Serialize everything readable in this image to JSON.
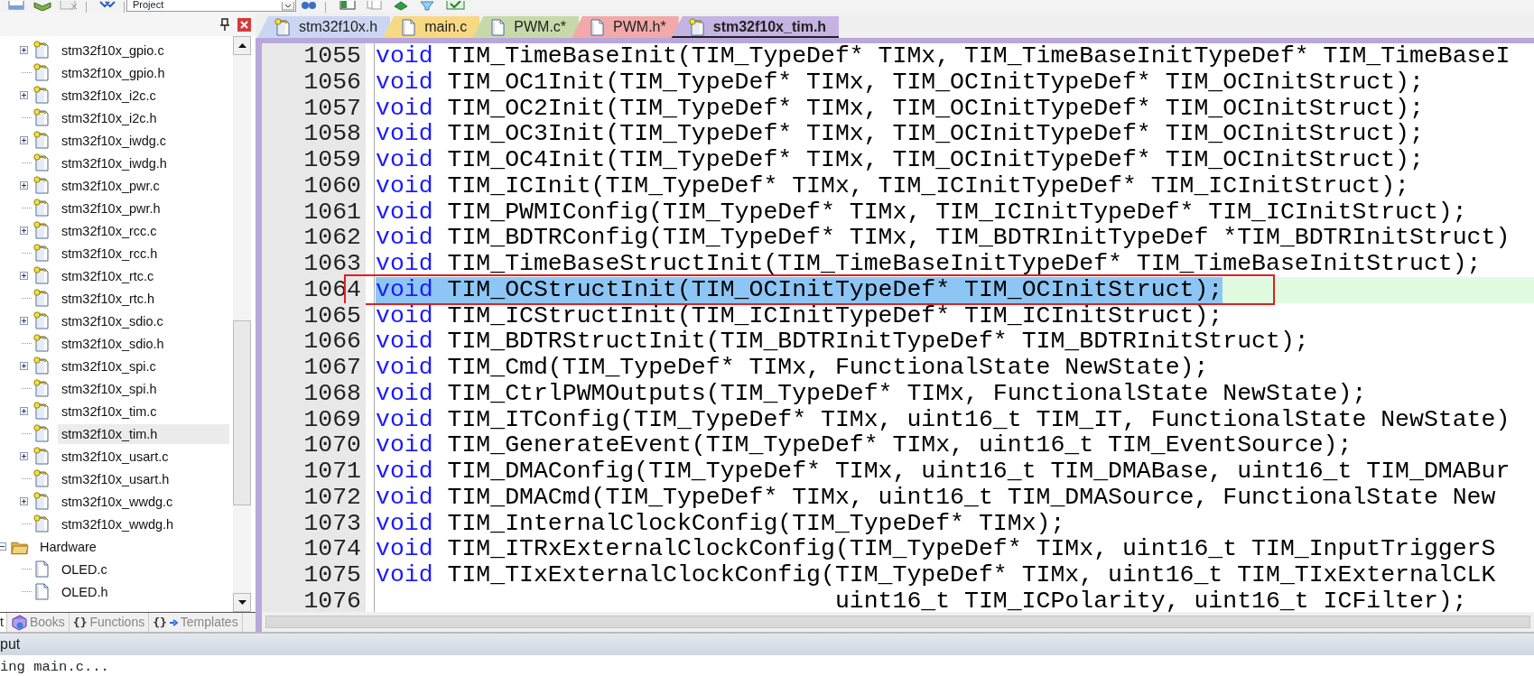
{
  "toolbar": {
    "project_select": "Project"
  },
  "tree": [
    {
      "kind": "group-tail",
      "children": [
        {
          "label": "stm32f10x_gpio.c",
          "kind": "key-file",
          "expandable": true,
          "expanded": false,
          "selected": false
        },
        {
          "label": "stm32f10x_gpio.h",
          "kind": "key-file",
          "expandable": false,
          "expanded": false,
          "selected": false
        },
        {
          "label": "stm32f10x_i2c.c",
          "kind": "key-file",
          "expandable": true,
          "expanded": false,
          "selected": false
        },
        {
          "label": "stm32f10x_i2c.h",
          "kind": "key-file",
          "expandable": false,
          "expanded": false,
          "selected": false
        },
        {
          "label": "stm32f10x_iwdg.c",
          "kind": "key-file",
          "expandable": true,
          "expanded": false,
          "selected": false
        },
        {
          "label": "stm32f10x_iwdg.h",
          "kind": "key-file",
          "expandable": false,
          "expanded": false,
          "selected": false
        },
        {
          "label": "stm32f10x_pwr.c",
          "kind": "key-file",
          "expandable": true,
          "expanded": false,
          "selected": false
        },
        {
          "label": "stm32f10x_pwr.h",
          "kind": "key-file",
          "expandable": false,
          "expanded": false,
          "selected": false
        },
        {
          "label": "stm32f10x_rcc.c",
          "kind": "key-file",
          "expandable": true,
          "expanded": false,
          "selected": false
        },
        {
          "label": "stm32f10x_rcc.h",
          "kind": "key-file",
          "expandable": false,
          "expanded": false,
          "selected": false
        },
        {
          "label": "stm32f10x_rtc.c",
          "kind": "key-file",
          "expandable": true,
          "expanded": false,
          "selected": false
        },
        {
          "label": "stm32f10x_rtc.h",
          "kind": "key-file",
          "expandable": false,
          "expanded": false,
          "selected": false
        },
        {
          "label": "stm32f10x_sdio.c",
          "kind": "key-file",
          "expandable": true,
          "expanded": false,
          "selected": false
        },
        {
          "label": "stm32f10x_sdio.h",
          "kind": "key-file",
          "expandable": false,
          "expanded": false,
          "selected": false
        },
        {
          "label": "stm32f10x_spi.c",
          "kind": "key-file",
          "expandable": true,
          "expanded": false,
          "selected": false
        },
        {
          "label": "stm32f10x_spi.h",
          "kind": "key-file",
          "expandable": false,
          "expanded": false,
          "selected": false
        },
        {
          "label": "stm32f10x_tim.c",
          "kind": "key-file",
          "expandable": true,
          "expanded": false,
          "selected": false
        },
        {
          "label": "stm32f10x_tim.h",
          "kind": "key-file",
          "expandable": false,
          "expanded": false,
          "selected": true
        },
        {
          "label": "stm32f10x_usart.c",
          "kind": "key-file",
          "expandable": true,
          "expanded": false,
          "selected": false
        },
        {
          "label": "stm32f10x_usart.h",
          "kind": "key-file",
          "expandable": false,
          "expanded": false,
          "selected": false
        },
        {
          "label": "stm32f10x_wwdg.c",
          "kind": "key-file",
          "expandable": true,
          "expanded": false,
          "selected": false
        },
        {
          "label": "stm32f10x_wwdg.h",
          "kind": "key-file",
          "expandable": false,
          "expanded": false,
          "selected": false
        }
      ]
    },
    {
      "label": "Hardware",
      "kind": "folder",
      "expandable": true,
      "expanded": true,
      "selected": false,
      "children": [
        {
          "label": "OLED.c",
          "kind": "file",
          "expandable": false,
          "expanded": false,
          "selected": false
        },
        {
          "label": "OLED.h",
          "kind": "file",
          "expandable": false,
          "expanded": false,
          "selected": false
        }
      ]
    }
  ],
  "panel_tabs": [
    {
      "label": "t",
      "kind": "project",
      "selected": true
    },
    {
      "label": "Books",
      "kind": "books",
      "selected": false
    },
    {
      "label": "Functions",
      "kind": "functions",
      "icon_text": "{}",
      "selected": false
    },
    {
      "label": "Templates",
      "kind": "templates",
      "icon_text": "{}",
      "selected": false
    }
  ],
  "editor_tabs": [
    {
      "label": "stm32f10x.h",
      "kind": "key-file",
      "color": "#cbd7f2",
      "selected": false
    },
    {
      "label": "main.c",
      "kind": "file",
      "color": "#f8d983",
      "selected": false
    },
    {
      "label": "PWM.c*",
      "kind": "file",
      "color": "#c8d9a9",
      "selected": false
    },
    {
      "label": "PWM.h*",
      "kind": "file",
      "color": "#f2a9a9",
      "selected": false
    },
    {
      "label": "stm32f10x_tim.h",
      "kind": "key-file",
      "color": "#c5b3e3",
      "selected": true
    }
  ],
  "code_lines": [
    {
      "number": "1055",
      "tokens": [
        {
          "kind": "keyword",
          "text": "void"
        },
        {
          "kind": "plain",
          "text": " TIM_TimeBaseInit(TIM_TypeDef* TIMx, TIM_TimeBaseInitTypeDef* TIM_TimeBaseI"
        }
      ],
      "selected": false,
      "current": false,
      "boxed": false
    },
    {
      "number": "1056",
      "tokens": [
        {
          "kind": "keyword",
          "text": "void"
        },
        {
          "kind": "plain",
          "text": " TIM_OC1Init(TIM_TypeDef* TIMx, TIM_OCInitTypeDef* TIM_OCInitStruct);"
        }
      ],
      "selected": false,
      "current": false,
      "boxed": false
    },
    {
      "number": "1057",
      "tokens": [
        {
          "kind": "keyword",
          "text": "void"
        },
        {
          "kind": "plain",
          "text": " TIM_OC2Init(TIM_TypeDef* TIMx, TIM_OCInitTypeDef* TIM_OCInitStruct);"
        }
      ],
      "selected": false,
      "current": false,
      "boxed": false
    },
    {
      "number": "1058",
      "tokens": [
        {
          "kind": "keyword",
          "text": "void"
        },
        {
          "kind": "plain",
          "text": " TIM_OC3Init(TIM_TypeDef* TIMx, TIM_OCInitTypeDef* TIM_OCInitStruct);"
        }
      ],
      "selected": false,
      "current": false,
      "boxed": false
    },
    {
      "number": "1059",
      "tokens": [
        {
          "kind": "keyword",
          "text": "void"
        },
        {
          "kind": "plain",
          "text": " TIM_OC4Init(TIM_TypeDef* TIMx, TIM_OCInitTypeDef* TIM_OCInitStruct);"
        }
      ],
      "selected": false,
      "current": false,
      "boxed": false
    },
    {
      "number": "1060",
      "tokens": [
        {
          "kind": "keyword",
          "text": "void"
        },
        {
          "kind": "plain",
          "text": " TIM_ICInit(TIM_TypeDef* TIMx, TIM_ICInitTypeDef* TIM_ICInitStruct);"
        }
      ],
      "selected": false,
      "current": false,
      "boxed": false
    },
    {
      "number": "1061",
      "tokens": [
        {
          "kind": "keyword",
          "text": "void"
        },
        {
          "kind": "plain",
          "text": " TIM_PWMIConfig(TIM_TypeDef* TIMx, TIM_ICInitTypeDef* TIM_ICInitStruct);"
        }
      ],
      "selected": false,
      "current": false,
      "boxed": false
    },
    {
      "number": "1062",
      "tokens": [
        {
          "kind": "keyword",
          "text": "void"
        },
        {
          "kind": "plain",
          "text": " TIM_BDTRConfig(TIM_TypeDef* TIMx, TIM_BDTRInitTypeDef *TIM_BDTRInitStruct)"
        }
      ],
      "selected": false,
      "current": false,
      "boxed": false
    },
    {
      "number": "1063",
      "tokens": [
        {
          "kind": "keyword",
          "text": "void"
        },
        {
          "kind": "plain",
          "text": " TIM_TimeBaseStructInit(TIM_TimeBaseInitTypeDef* TIM_TimeBaseInitStruct);"
        }
      ],
      "selected": false,
      "current": false,
      "boxed": false
    },
    {
      "number": "1064",
      "tokens": [
        {
          "kind": "keyword",
          "text": "void"
        },
        {
          "kind": "plain",
          "text": " TIM_OCStructInit(TIM_OCInitTypeDef* TIM_OCInitStruct);"
        }
      ],
      "selected": true,
      "current": true,
      "boxed": true
    },
    {
      "number": "1065",
      "tokens": [
        {
          "kind": "keyword",
          "text": "void"
        },
        {
          "kind": "plain",
          "text": " TIM_ICStructInit(TIM_ICInitTypeDef* TIM_ICInitStruct);"
        }
      ],
      "selected": false,
      "current": false,
      "boxed": false
    },
    {
      "number": "1066",
      "tokens": [
        {
          "kind": "keyword",
          "text": "void"
        },
        {
          "kind": "plain",
          "text": " TIM_BDTRStructInit(TIM_BDTRInitTypeDef* TIM_BDTRInitStruct);"
        }
      ],
      "selected": false,
      "current": false,
      "boxed": false
    },
    {
      "number": "1067",
      "tokens": [
        {
          "kind": "keyword",
          "text": "void"
        },
        {
          "kind": "plain",
          "text": " TIM_Cmd(TIM_TypeDef* TIMx, FunctionalState NewState);"
        }
      ],
      "selected": false,
      "current": false,
      "boxed": false
    },
    {
      "number": "1068",
      "tokens": [
        {
          "kind": "keyword",
          "text": "void"
        },
        {
          "kind": "plain",
          "text": " TIM_CtrlPWMOutputs(TIM_TypeDef* TIMx, FunctionalState NewState);"
        }
      ],
      "selected": false,
      "current": false,
      "boxed": false
    },
    {
      "number": "1069",
      "tokens": [
        {
          "kind": "keyword",
          "text": "void"
        },
        {
          "kind": "plain",
          "text": " TIM_ITConfig(TIM_TypeDef* TIMx, uint16_t TIM_IT, FunctionalState NewState)"
        }
      ],
      "selected": false,
      "current": false,
      "boxed": false
    },
    {
      "number": "1070",
      "tokens": [
        {
          "kind": "keyword",
          "text": "void"
        },
        {
          "kind": "plain",
          "text": " TIM_GenerateEvent(TIM_TypeDef* TIMx, uint16_t TIM_EventSource);"
        }
      ],
      "selected": false,
      "current": false,
      "boxed": false
    },
    {
      "number": "1071",
      "tokens": [
        {
          "kind": "keyword",
          "text": "void"
        },
        {
          "kind": "plain",
          "text": " TIM_DMAConfig(TIM_TypeDef* TIMx, uint16_t TIM_DMABase, uint16_t TIM_DMABur"
        }
      ],
      "selected": false,
      "current": false,
      "boxed": false
    },
    {
      "number": "1072",
      "tokens": [
        {
          "kind": "keyword",
          "text": "void"
        },
        {
          "kind": "plain",
          "text": " TIM_DMACmd(TIM_TypeDef* TIMx, uint16_t TIM_DMASource, FunctionalState New"
        }
      ],
      "selected": false,
      "current": false,
      "boxed": false
    },
    {
      "number": "1073",
      "tokens": [
        {
          "kind": "keyword",
          "text": "void"
        },
        {
          "kind": "plain",
          "text": " TIM_InternalClockConfig(TIM_TypeDef* TIMx);"
        }
      ],
      "selected": false,
      "current": false,
      "boxed": false
    },
    {
      "number": "1074",
      "tokens": [
        {
          "kind": "keyword",
          "text": "void"
        },
        {
          "kind": "plain",
          "text": " TIM_ITRxExternalClockConfig(TIM_TypeDef* TIMx, uint16_t TIM_InputTriggerS"
        }
      ],
      "selected": false,
      "current": false,
      "boxed": false
    },
    {
      "number": "1075",
      "tokens": [
        {
          "kind": "keyword",
          "text": "void"
        },
        {
          "kind": "plain",
          "text": " TIM_TIxExternalClockConfig(TIM_TypeDef* TIMx, uint16_t TIM_TIxExternalCLK"
        }
      ],
      "selected": false,
      "current": false,
      "boxed": false
    },
    {
      "number": "1076",
      "tokens": [
        {
          "kind": "plain",
          "text": "                                uint16_t TIM_ICPolarity, uint16_t ICFilter);"
        }
      ],
      "selected": false,
      "current": false,
      "boxed": false
    }
  ],
  "output": {
    "title": "put",
    "lines": [
      "ing main.c..."
    ]
  }
}
